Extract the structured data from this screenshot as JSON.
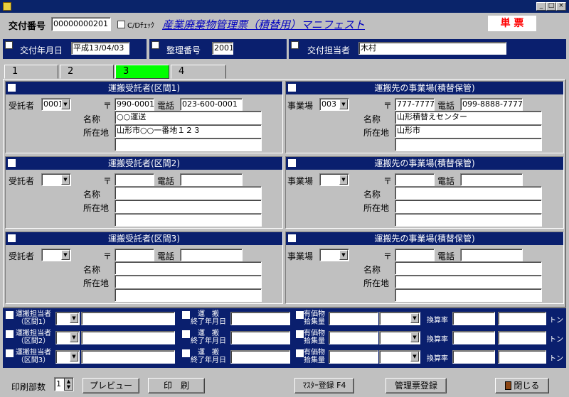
{
  "header": {
    "app_icon": "app-icon",
    "window_controls": [
      "_",
      "□",
      "×"
    ],
    "issue_no_label": "交付番号",
    "issue_no_value": "00000000201",
    "cd_check_label": "C/Dﾁｪｯｸ",
    "title": "産業廃棄物管理票（積替用）マニフェスト",
    "single_slip": "単 票"
  },
  "info": {
    "issue_date_label": "交付年月日",
    "issue_date_value": "平成13/04/03",
    "manage_no_label": "整理番号",
    "manage_no_value": "2001",
    "issuer_label": "交付担当者",
    "issuer_value": "木村"
  },
  "tabs": [
    "1",
    "2",
    "3",
    "4"
  ],
  "left_sections": [
    {
      "title": "運搬受託者(区間1)",
      "contractor_label": "受託者",
      "contractor_value": "0001",
      "zip_mark": "〒",
      "zip": "990-0001",
      "tel_label": "電話",
      "tel": "023-600-0001",
      "name_label": "名称",
      "name": "○○運送",
      "addr_label": "所在地",
      "addr": "山形市○○一番地１２３"
    },
    {
      "title": "運搬受託者(区間2)",
      "contractor_label": "受託者",
      "contractor_value": "",
      "zip_mark": "〒",
      "zip": "",
      "tel_label": "電話",
      "tel": "",
      "name_label": "名称",
      "name": "",
      "addr_label": "所在地",
      "addr": ""
    },
    {
      "title": "運搬受託者(区間3)",
      "contractor_label": "受託者",
      "contractor_value": "",
      "zip_mark": "〒",
      "zip": "",
      "tel_label": "電話",
      "tel": "",
      "name_label": "名称",
      "name": "",
      "addr_label": "所在地",
      "addr": ""
    }
  ],
  "right_sections": [
    {
      "title": "運搬先の事業場(積替保管)",
      "site_label": "事業場",
      "site_value": "003",
      "zip_mark": "〒",
      "zip": "777-7777",
      "tel_label": "電話",
      "tel": "099-8888-7777",
      "name_label": "名称",
      "name": "山形積替えセンター",
      "addr_label": "所在地",
      "addr": "山形市"
    },
    {
      "title": "運搬先の事業場(積替保管)",
      "site_label": "事業場",
      "site_value": "",
      "zip_mark": "〒",
      "zip": "",
      "tel_label": "電話",
      "tel": "",
      "name_label": "名称",
      "name": "",
      "addr_label": "所在地",
      "addr": ""
    },
    {
      "title": "運搬先の事業場(積替保管)",
      "site_label": "事業場",
      "site_value": "",
      "zip_mark": "〒",
      "zip": "",
      "tel_label": "電話",
      "tel": "",
      "name_label": "名称",
      "name": "",
      "addr_label": "所在地",
      "addr": ""
    }
  ],
  "bottom_rows": [
    {
      "driver_label_1": "運搬担当者",
      "driver_label_2": "（区間1）",
      "end_label_1": "運　搬",
      "end_label_2": "終了年月日",
      "valuable_label_1": "有価物",
      "valuable_label_2": "拾集量",
      "rate_label": "換算率",
      "unit": "トン"
    },
    {
      "driver_label_1": "運搬担当者",
      "driver_label_2": "（区間2）",
      "end_label_1": "運　搬",
      "end_label_2": "終了年月日",
      "valuable_label_1": "有価物",
      "valuable_label_2": "拾集量",
      "rate_label": "換算率",
      "unit": "トン"
    },
    {
      "driver_label_1": "運搬担当者",
      "driver_label_2": "（区間3）",
      "end_label_1": "運　搬",
      "end_label_2": "終了年月日",
      "valuable_label_1": "有価物",
      "valuable_label_2": "拾集量",
      "rate_label": "換算率",
      "unit": "トン"
    }
  ],
  "footer": {
    "copies_label": "印刷部数",
    "copies_value": "1",
    "preview": "プレビュー",
    "print": "印　刷",
    "master": "ﾏｽﾀｰ登録 F4",
    "register": "管理票登録",
    "close": "閉じる"
  }
}
